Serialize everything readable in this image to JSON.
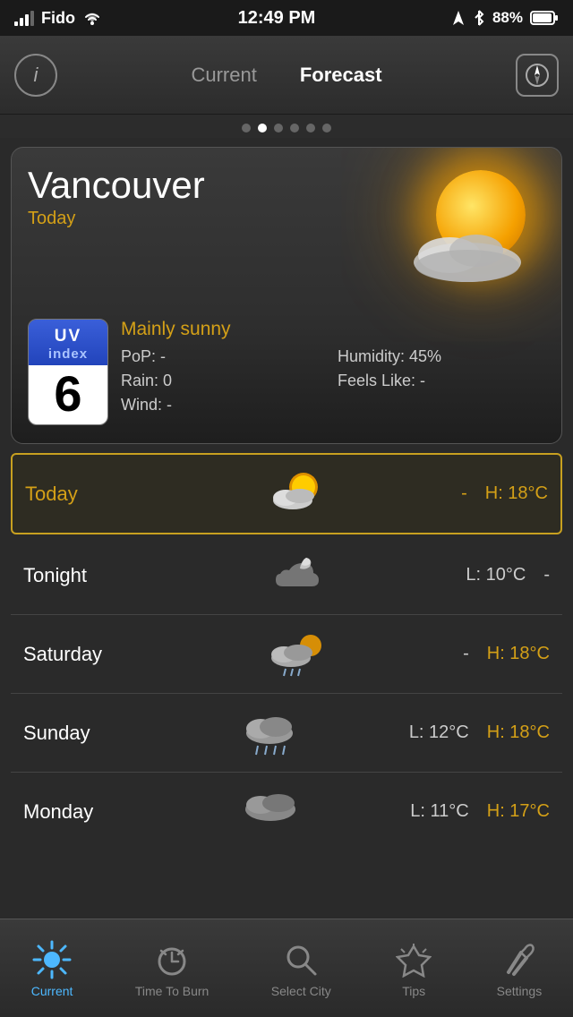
{
  "statusBar": {
    "carrier": "Fido",
    "time": "12:49 PM",
    "battery": "88%"
  },
  "navBar": {
    "infoLabel": "i",
    "currentTab": "Current",
    "forecastTab": "Forecast",
    "activeTab": "forecast"
  },
  "weatherCard": {
    "city": "Vancouver",
    "dayLabel": "Today",
    "condition": "Mainly sunny",
    "uvLabel": "UV",
    "uvSub": "index",
    "uvValue": "6",
    "pop": "PoP: -",
    "humidity": "Humidity: 45%",
    "rain": "Rain: 0",
    "feelsLike": "Feels Like: -",
    "wind": "Wind: -"
  },
  "forecast": [
    {
      "day": "Today",
      "low": "-",
      "high": "H: 18°C",
      "highlighted": true,
      "icon": "partly_sunny"
    },
    {
      "day": "Tonight",
      "low": "L: 10°C",
      "high": "-",
      "highlighted": false,
      "icon": "partly_cloudy_night"
    },
    {
      "day": "Saturday",
      "low": "-",
      "high": "H: 18°C",
      "highlighted": false,
      "icon": "partly_sunny_rain"
    },
    {
      "day": "Sunday",
      "low": "L: 12°C",
      "high": "H: 18°C",
      "highlighted": false,
      "icon": "cloudy_rain"
    },
    {
      "day": "Monday",
      "low": "L: 11°C",
      "high": "H: 17°C",
      "highlighted": false,
      "icon": "cloudy"
    }
  ],
  "tabBar": {
    "tabs": [
      {
        "id": "current",
        "label": "Current",
        "active": true
      },
      {
        "id": "burn",
        "label": "Time To Burn",
        "active": false
      },
      {
        "id": "city",
        "label": "Select City",
        "active": false
      },
      {
        "id": "tips",
        "label": "Tips",
        "active": false
      },
      {
        "id": "settings",
        "label": "Settings",
        "active": false
      }
    ]
  }
}
